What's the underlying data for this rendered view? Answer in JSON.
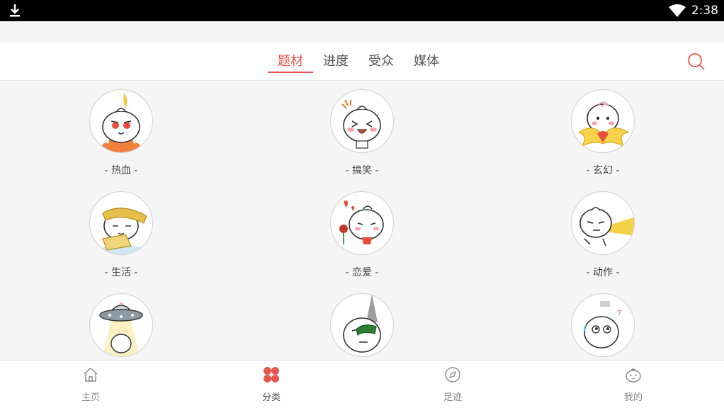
{
  "status_bar": {
    "time": "2:38",
    "icons": [
      "download-icon",
      "wifi-icon"
    ]
  },
  "top_tabs": [
    {
      "label": "题材",
      "active": true
    },
    {
      "label": "进度",
      "active": false
    },
    {
      "label": "受众",
      "active": false
    },
    {
      "label": "媒体",
      "active": false
    }
  ],
  "search": {
    "icon": "search-icon",
    "accent_color": "#e8554e"
  },
  "categories": [
    {
      "label": "- 热血 -",
      "icon": "hot-blood-bun-icon"
    },
    {
      "label": "- 搞笑 -",
      "icon": "funny-bun-icon"
    },
    {
      "label": "- 玄幻 -",
      "icon": "fantasy-bun-icon"
    },
    {
      "label": "- 生活 -",
      "icon": "life-bun-icon"
    },
    {
      "label": "- 恋爱 -",
      "icon": "romance-bun-icon"
    },
    {
      "label": "- 动作 -",
      "icon": "action-bun-icon"
    },
    {
      "label": "",
      "icon": "scifi-ufo-bun-icon"
    },
    {
      "label": "",
      "icon": "mystery-bun-icon"
    },
    {
      "label": "",
      "icon": "thinking-bun-icon"
    }
  ],
  "bottom_nav": [
    {
      "label": "主页",
      "icon": "home-icon",
      "active": false
    },
    {
      "label": "分类",
      "icon": "category-icon",
      "active": true
    },
    {
      "label": "足迹",
      "icon": "compass-icon",
      "active": false
    },
    {
      "label": "我的",
      "icon": "profile-bun-icon",
      "active": false
    }
  ],
  "colors": {
    "accent": "#e8554e",
    "background": "#f5f5f5",
    "bar": "#ffffff"
  }
}
